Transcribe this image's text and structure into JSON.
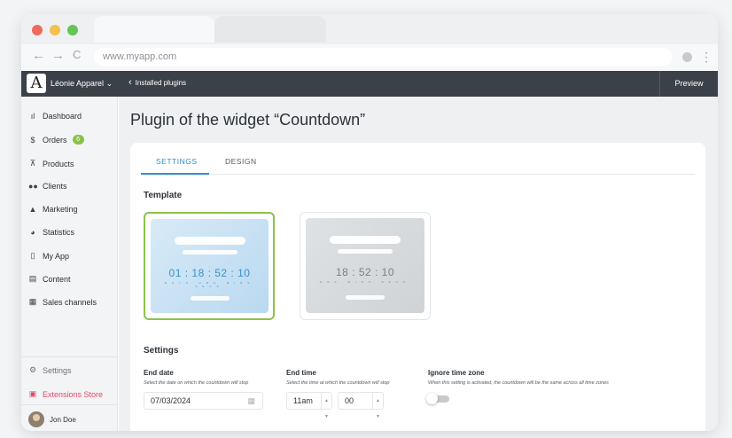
{
  "browser": {
    "url": "www.myapp.com",
    "dot_colors": [
      "#ee6a5e",
      "#f5bf4f",
      "#62c554"
    ]
  },
  "header": {
    "logo_letter": "A",
    "store_name": "Léonie Apparel",
    "back_label": "Installed plugins",
    "preview_label": "Preview"
  },
  "sidebar": {
    "items": [
      {
        "label": "Dashboard",
        "icon": "bar-chart-icon"
      },
      {
        "label": "Orders",
        "icon": "dollar-icon",
        "badge": "6"
      },
      {
        "label": "Products",
        "icon": "cart-icon"
      },
      {
        "label": "Clients",
        "icon": "users-icon"
      },
      {
        "label": "Marketing",
        "icon": "bell-icon"
      },
      {
        "label": "Statistics",
        "icon": "pie-chart-icon"
      },
      {
        "label": "My App",
        "icon": "phone-icon"
      },
      {
        "label": "Content",
        "icon": "document-icon"
      },
      {
        "label": "Sales channels",
        "icon": "store-icon"
      }
    ],
    "settings_label": "Settings",
    "extensions_label": "Extensions Store",
    "user_name": "Jon Doe"
  },
  "main": {
    "title": "Plugin of the widget “Countdown”",
    "tabs": [
      "SETTINGS",
      "DESIGN"
    ],
    "template_section": "Template",
    "templates": [
      {
        "timer": "01 : 18 : 52 : 10",
        "units": "DAYS HRS MINS SECS",
        "selected": true
      },
      {
        "timer": "18 : 52 : 10",
        "units": "HRS MINS SECS",
        "selected": false
      }
    ],
    "settings_section": "Settings",
    "end_date": {
      "label": "End date",
      "help": "Select the date on which the countdown will stop",
      "value": "07/03/2024"
    },
    "end_time": {
      "label": "End time",
      "help": "Select the time at which the countdown will stop",
      "hour": "11am",
      "minute": "00"
    },
    "ignore_tz": {
      "label": "Ignore time zone",
      "help": "When this setting is activated, the countdown will be the same across all time zones",
      "enabled": false
    }
  }
}
